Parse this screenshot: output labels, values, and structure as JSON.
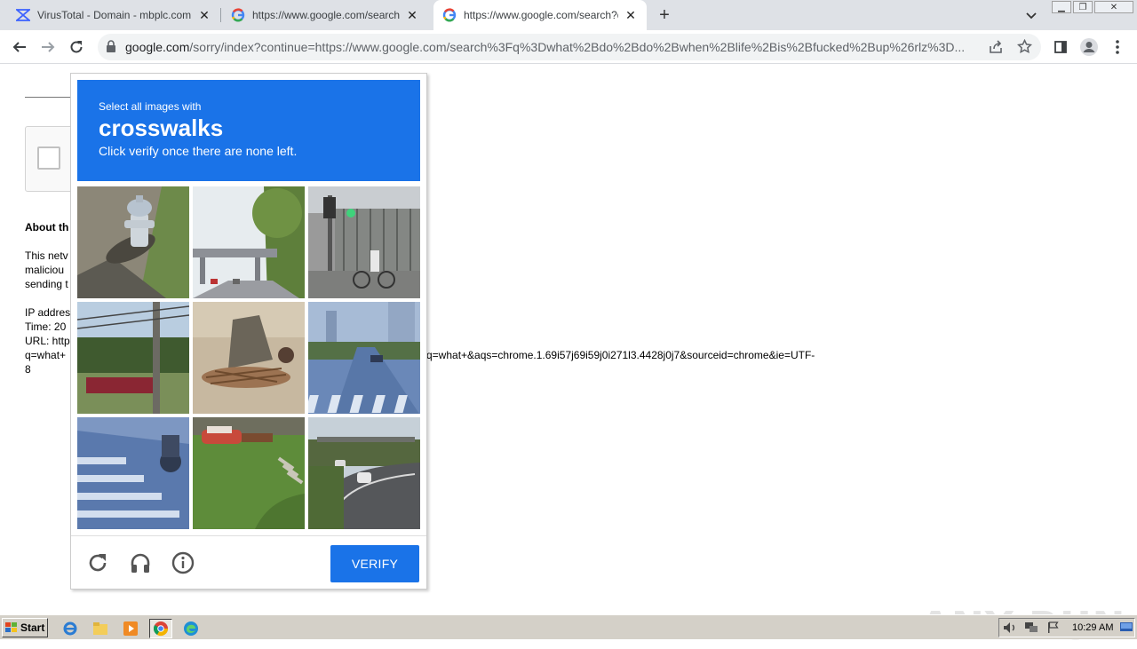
{
  "browser": {
    "tabs": [
      {
        "title": "VirusTotal - Domain - mbplc.com",
        "favicon": "virustotal-icon"
      },
      {
        "title": "https://www.google.com/search?q=",
        "favicon": "google-icon"
      },
      {
        "title": "https://www.google.com/search?q=",
        "favicon": "google-icon",
        "active": true
      }
    ],
    "new_tab": "+",
    "address_host": "google.com",
    "address_path": "/sorry/index?continue=https://www.google.com/search%3Fq%3Dwhat%2Bdo%2Bdo%2Bwhen%2Blife%2Bis%2Bfucked%2Bup%26rlz%3D..."
  },
  "page": {
    "about_heading": "About th",
    "para_lines": [
      "This netv",
      "maliciou",
      "sending t"
    ],
    "info_lines": [
      "IP addres",
      "Time: 20",
      "URL: http"
    ],
    "url_cont_left": "q=what+",
    "url_cont_right": "q=what+&aqs=chrome.1.69i57j69i59j0i271l3.4428j0j7&sourceid=chrome&ie=UTF-",
    "url_tail": "8"
  },
  "captcha": {
    "instruction_top": "Select all images with",
    "target": "crosswalks",
    "instruction_bottom": "Click verify once there are none left.",
    "tiles": [
      "fire-hydrant",
      "highway-overpass",
      "cyclist-traffic-light",
      "utility-pole-bus",
      "statue-woodpile",
      "street-crosswalk",
      "crosswalk-closeup",
      "lawn-classic-car",
      "road-curve-cars"
    ],
    "verify_label": "VERIFY",
    "accent": "#1a73e8"
  },
  "watermark": "ANY RUN",
  "taskbar": {
    "start_label": "Start",
    "clock": "10:29 AM"
  }
}
